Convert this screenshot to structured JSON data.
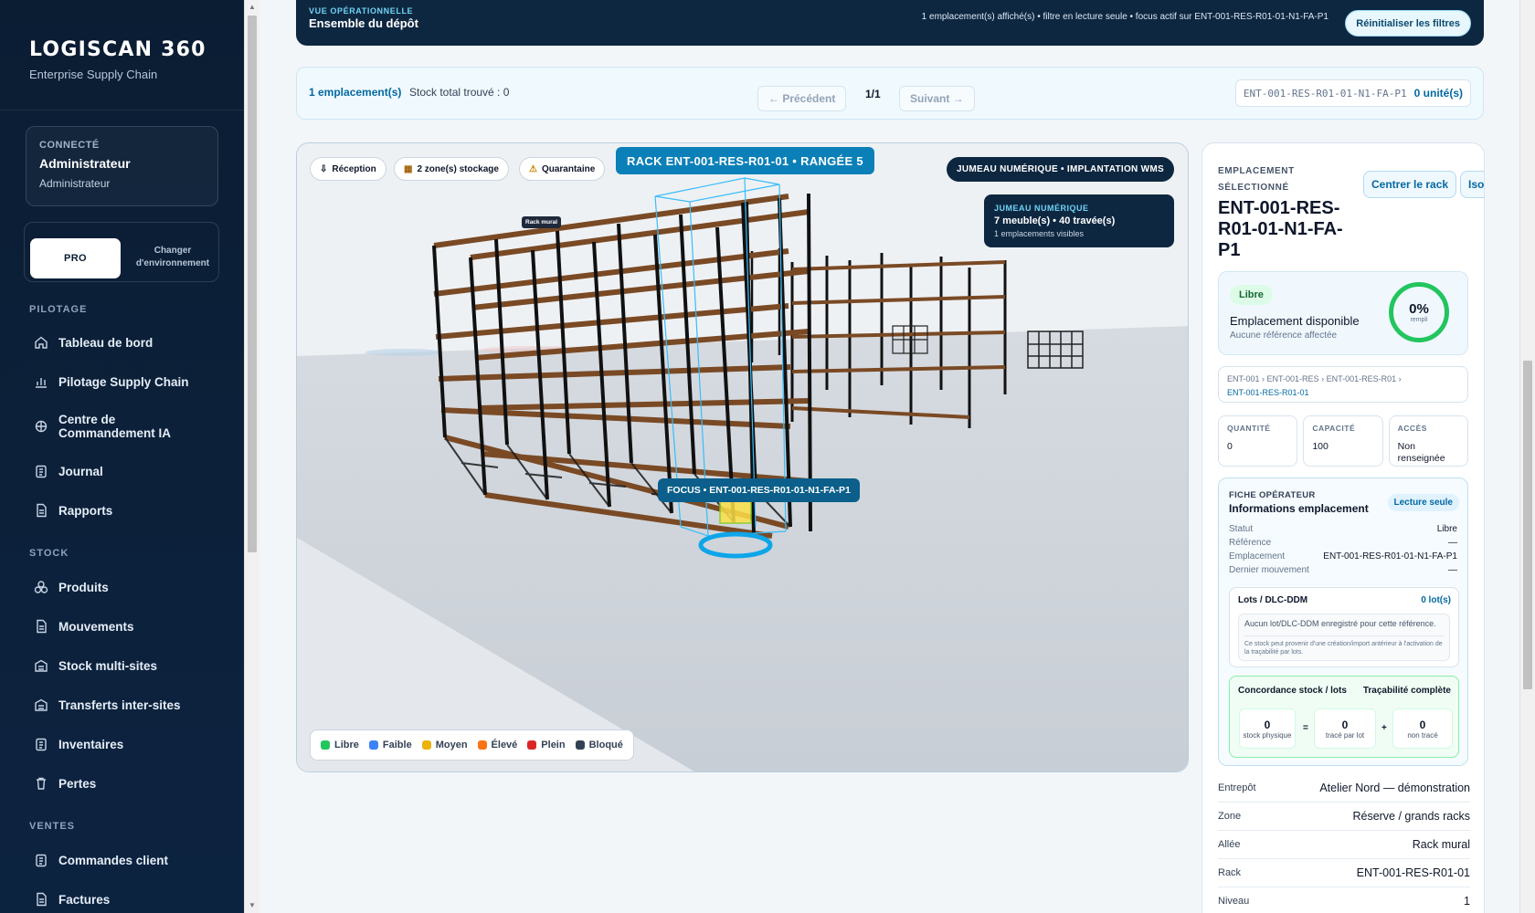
{
  "sidebar": {
    "brand": "LOGISCAN 360",
    "tagline": "Enterprise Supply Chain",
    "user": {
      "label": "CONNECTÉ",
      "name": "Administrateur",
      "role": "Administrateur"
    },
    "env": {
      "active": "PRO",
      "switch": "Changer d'environnement"
    },
    "sections": {
      "pilotage": "PILOTAGE",
      "stock": "STOCK",
      "ventes": "VENTES"
    },
    "pilotage_items": [
      {
        "label": "Tableau de bord",
        "icon": "home-icon"
      },
      {
        "label": "Pilotage Supply Chain",
        "icon": "bar-chart-icon"
      },
      {
        "label": "Centre de Commandement IA",
        "icon": "brain-icon"
      },
      {
        "label": "Journal",
        "icon": "clipboard-icon"
      },
      {
        "label": "Rapports",
        "icon": "document-icon"
      }
    ],
    "stock_items": [
      {
        "label": "Produits",
        "icon": "boxes-icon"
      },
      {
        "label": "Mouvements",
        "icon": "document-icon"
      },
      {
        "label": "Stock multi-sites",
        "icon": "warehouse-icon"
      },
      {
        "label": "Transferts inter-sites",
        "icon": "warehouse-icon"
      },
      {
        "label": "Inventaires",
        "icon": "clipboard-icon"
      },
      {
        "label": "Pertes",
        "icon": "trash-icon"
      }
    ],
    "ventes_items": [
      {
        "label": "Commandes client",
        "icon": "clipboard-icon"
      },
      {
        "label": "Factures",
        "icon": "document-icon"
      }
    ]
  },
  "header": {
    "kicker": "VUE OPÉRATIONNELLE",
    "title": "Ensemble du dépôt",
    "info": "1 emplacement(s) affiché(s) • filtre en lecture seule • focus actif sur ENT-001-RES-R01-01-N1-FA-P1",
    "reset": "Réinitialiser les filtres"
  },
  "pager": {
    "count": "1 emplacement(s)",
    "total": "Stock total trouvé : 0",
    "prev": "← Précédent",
    "page": "1/1",
    "next": "Suivant →",
    "location_code": "ENT-001-RES-R01-01-N1-FA-P1",
    "units": "0 unité(s)"
  },
  "scene": {
    "chips": [
      "Réception",
      "2 zone(s) stockage",
      "Quarantaine"
    ],
    "rack_title": "RACK ENT-001-RES-R01-01 • RANGÉE 5",
    "twin_badge": "JUMEAU NUMÉRIQUE • IMPLANTATION WMS",
    "twin_card": {
      "kicker": "JUMEAU NUMÉRIQUE",
      "value": "7 meuble(s) • 40 travée(s)",
      "sub": "1 emplacements visibles"
    },
    "rack_tag": "Rack mural",
    "focus": "FOCUS • ENT-001-RES-R01-01-N1-FA-P1",
    "legend": [
      {
        "label": "Libre",
        "color": "#22c55e"
      },
      {
        "label": "Faible",
        "color": "#3b82f6"
      },
      {
        "label": "Moyen",
        "color": "#eab308"
      },
      {
        "label": "Élevé",
        "color": "#f97316"
      },
      {
        "label": "Plein",
        "color": "#dc2626"
      },
      {
        "label": "Bloqué",
        "color": "#334155"
      }
    ]
  },
  "panel": {
    "kicker": "EMPLACEMENT SÉLECTIONNÉ",
    "center_btn": "Centrer le rack",
    "isolate_btn": "Isoler le rack",
    "location_name": "ENT-001-RES-R01-01-N1-FA-P1",
    "status": {
      "pill": "Libre",
      "title": "Emplacement disponible",
      "sub": "Aucune référence affectée",
      "fill_percent": "0%",
      "fill_label": "rempli"
    },
    "breadcrumb": [
      "ENT-001",
      "ENT-001-RES",
      "ENT-001-RES-R01",
      "ENT-001-RES-R01-01"
    ],
    "metrics": [
      {
        "label": "QUANTITÉ",
        "value": "0"
      },
      {
        "label": "CAPACITÉ",
        "value": "100"
      },
      {
        "label": "ACCÈS",
        "value": "Non renseignée"
      }
    ],
    "fiche": {
      "kicker": "FICHE OPÉRATEUR",
      "title": "Informations emplacement",
      "badge": "Lecture seule",
      "rows": [
        {
          "k": "Statut",
          "v": "Libre"
        },
        {
          "k": "Référence",
          "v": "—"
        },
        {
          "k": "Emplacement",
          "v": "ENT-001-RES-R01-01-N1-FA-P1"
        },
        {
          "k": "Dernier mouvement",
          "v": "—"
        }
      ],
      "lots": {
        "title": "Lots / DLC-DDM",
        "count": "0 lot(s)",
        "msg": "Aucun lot/DLC-DDM enregistré pour cette référence.",
        "note": "Ce stock peut provenir d'une création/import antérieur à l'activation de la traçabilité par lots."
      },
      "concordance": {
        "title": "Concordance stock / lots",
        "result": "Traçabilité complète",
        "boxes": [
          {
            "v": "0",
            "l": "stock physique"
          },
          {
            "v": "0",
            "l": "tracé par lot"
          },
          {
            "v": "0",
            "l": "non tracé"
          }
        ],
        "ops": [
          "=",
          "+"
        ]
      }
    },
    "details": [
      {
        "k": "Entrepôt",
        "v": "Atelier Nord — démonstration"
      },
      {
        "k": "Zone",
        "v": "Réserve / grands racks"
      },
      {
        "k": "Allée",
        "v": "Rack mural"
      },
      {
        "k": "Rack",
        "v": "ENT-001-RES-R01-01"
      },
      {
        "k": "Niveau",
        "v": "1"
      }
    ]
  }
}
